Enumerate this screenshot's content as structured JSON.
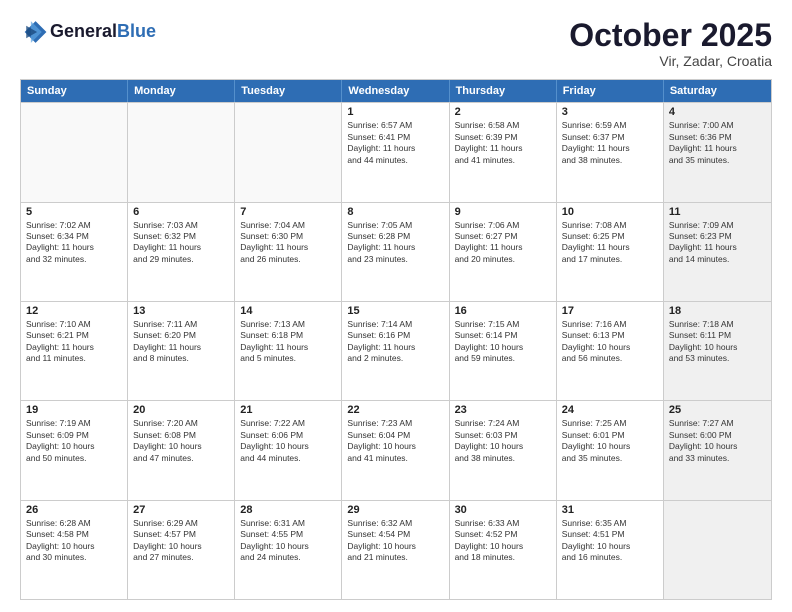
{
  "header": {
    "logo_line1": "General",
    "logo_line2": "Blue",
    "month": "October 2025",
    "location": "Vir, Zadar, Croatia"
  },
  "weekdays": [
    "Sunday",
    "Monday",
    "Tuesday",
    "Wednesday",
    "Thursday",
    "Friday",
    "Saturday"
  ],
  "rows": [
    [
      {
        "day": "",
        "info": "",
        "empty": true
      },
      {
        "day": "",
        "info": "",
        "empty": true
      },
      {
        "day": "",
        "info": "",
        "empty": true
      },
      {
        "day": "1",
        "info": "Sunrise: 6:57 AM\nSunset: 6:41 PM\nDaylight: 11 hours\nand 44 minutes."
      },
      {
        "day": "2",
        "info": "Sunrise: 6:58 AM\nSunset: 6:39 PM\nDaylight: 11 hours\nand 41 minutes."
      },
      {
        "day": "3",
        "info": "Sunrise: 6:59 AM\nSunset: 6:37 PM\nDaylight: 11 hours\nand 38 minutes."
      },
      {
        "day": "4",
        "info": "Sunrise: 7:00 AM\nSunset: 6:36 PM\nDaylight: 11 hours\nand 35 minutes.",
        "shaded": true
      }
    ],
    [
      {
        "day": "5",
        "info": "Sunrise: 7:02 AM\nSunset: 6:34 PM\nDaylight: 11 hours\nand 32 minutes."
      },
      {
        "day": "6",
        "info": "Sunrise: 7:03 AM\nSunset: 6:32 PM\nDaylight: 11 hours\nand 29 minutes."
      },
      {
        "day": "7",
        "info": "Sunrise: 7:04 AM\nSunset: 6:30 PM\nDaylight: 11 hours\nand 26 minutes."
      },
      {
        "day": "8",
        "info": "Sunrise: 7:05 AM\nSunset: 6:28 PM\nDaylight: 11 hours\nand 23 minutes."
      },
      {
        "day": "9",
        "info": "Sunrise: 7:06 AM\nSunset: 6:27 PM\nDaylight: 11 hours\nand 20 minutes."
      },
      {
        "day": "10",
        "info": "Sunrise: 7:08 AM\nSunset: 6:25 PM\nDaylight: 11 hours\nand 17 minutes."
      },
      {
        "day": "11",
        "info": "Sunrise: 7:09 AM\nSunset: 6:23 PM\nDaylight: 11 hours\nand 14 minutes.",
        "shaded": true
      }
    ],
    [
      {
        "day": "12",
        "info": "Sunrise: 7:10 AM\nSunset: 6:21 PM\nDaylight: 11 hours\nand 11 minutes."
      },
      {
        "day": "13",
        "info": "Sunrise: 7:11 AM\nSunset: 6:20 PM\nDaylight: 11 hours\nand 8 minutes."
      },
      {
        "day": "14",
        "info": "Sunrise: 7:13 AM\nSunset: 6:18 PM\nDaylight: 11 hours\nand 5 minutes."
      },
      {
        "day": "15",
        "info": "Sunrise: 7:14 AM\nSunset: 6:16 PM\nDaylight: 11 hours\nand 2 minutes."
      },
      {
        "day": "16",
        "info": "Sunrise: 7:15 AM\nSunset: 6:14 PM\nDaylight: 10 hours\nand 59 minutes."
      },
      {
        "day": "17",
        "info": "Sunrise: 7:16 AM\nSunset: 6:13 PM\nDaylight: 10 hours\nand 56 minutes."
      },
      {
        "day": "18",
        "info": "Sunrise: 7:18 AM\nSunset: 6:11 PM\nDaylight: 10 hours\nand 53 minutes.",
        "shaded": true
      }
    ],
    [
      {
        "day": "19",
        "info": "Sunrise: 7:19 AM\nSunset: 6:09 PM\nDaylight: 10 hours\nand 50 minutes."
      },
      {
        "day": "20",
        "info": "Sunrise: 7:20 AM\nSunset: 6:08 PM\nDaylight: 10 hours\nand 47 minutes."
      },
      {
        "day": "21",
        "info": "Sunrise: 7:22 AM\nSunset: 6:06 PM\nDaylight: 10 hours\nand 44 minutes."
      },
      {
        "day": "22",
        "info": "Sunrise: 7:23 AM\nSunset: 6:04 PM\nDaylight: 10 hours\nand 41 minutes."
      },
      {
        "day": "23",
        "info": "Sunrise: 7:24 AM\nSunset: 6:03 PM\nDaylight: 10 hours\nand 38 minutes."
      },
      {
        "day": "24",
        "info": "Sunrise: 7:25 AM\nSunset: 6:01 PM\nDaylight: 10 hours\nand 35 minutes."
      },
      {
        "day": "25",
        "info": "Sunrise: 7:27 AM\nSunset: 6:00 PM\nDaylight: 10 hours\nand 33 minutes.",
        "shaded": true
      }
    ],
    [
      {
        "day": "26",
        "info": "Sunrise: 6:28 AM\nSunset: 4:58 PM\nDaylight: 10 hours\nand 30 minutes."
      },
      {
        "day": "27",
        "info": "Sunrise: 6:29 AM\nSunset: 4:57 PM\nDaylight: 10 hours\nand 27 minutes."
      },
      {
        "day": "28",
        "info": "Sunrise: 6:31 AM\nSunset: 4:55 PM\nDaylight: 10 hours\nand 24 minutes."
      },
      {
        "day": "29",
        "info": "Sunrise: 6:32 AM\nSunset: 4:54 PM\nDaylight: 10 hours\nand 21 minutes."
      },
      {
        "day": "30",
        "info": "Sunrise: 6:33 AM\nSunset: 4:52 PM\nDaylight: 10 hours\nand 18 minutes."
      },
      {
        "day": "31",
        "info": "Sunrise: 6:35 AM\nSunset: 4:51 PM\nDaylight: 10 hours\nand 16 minutes."
      },
      {
        "day": "",
        "info": "",
        "empty": true,
        "shaded": true
      }
    ]
  ]
}
